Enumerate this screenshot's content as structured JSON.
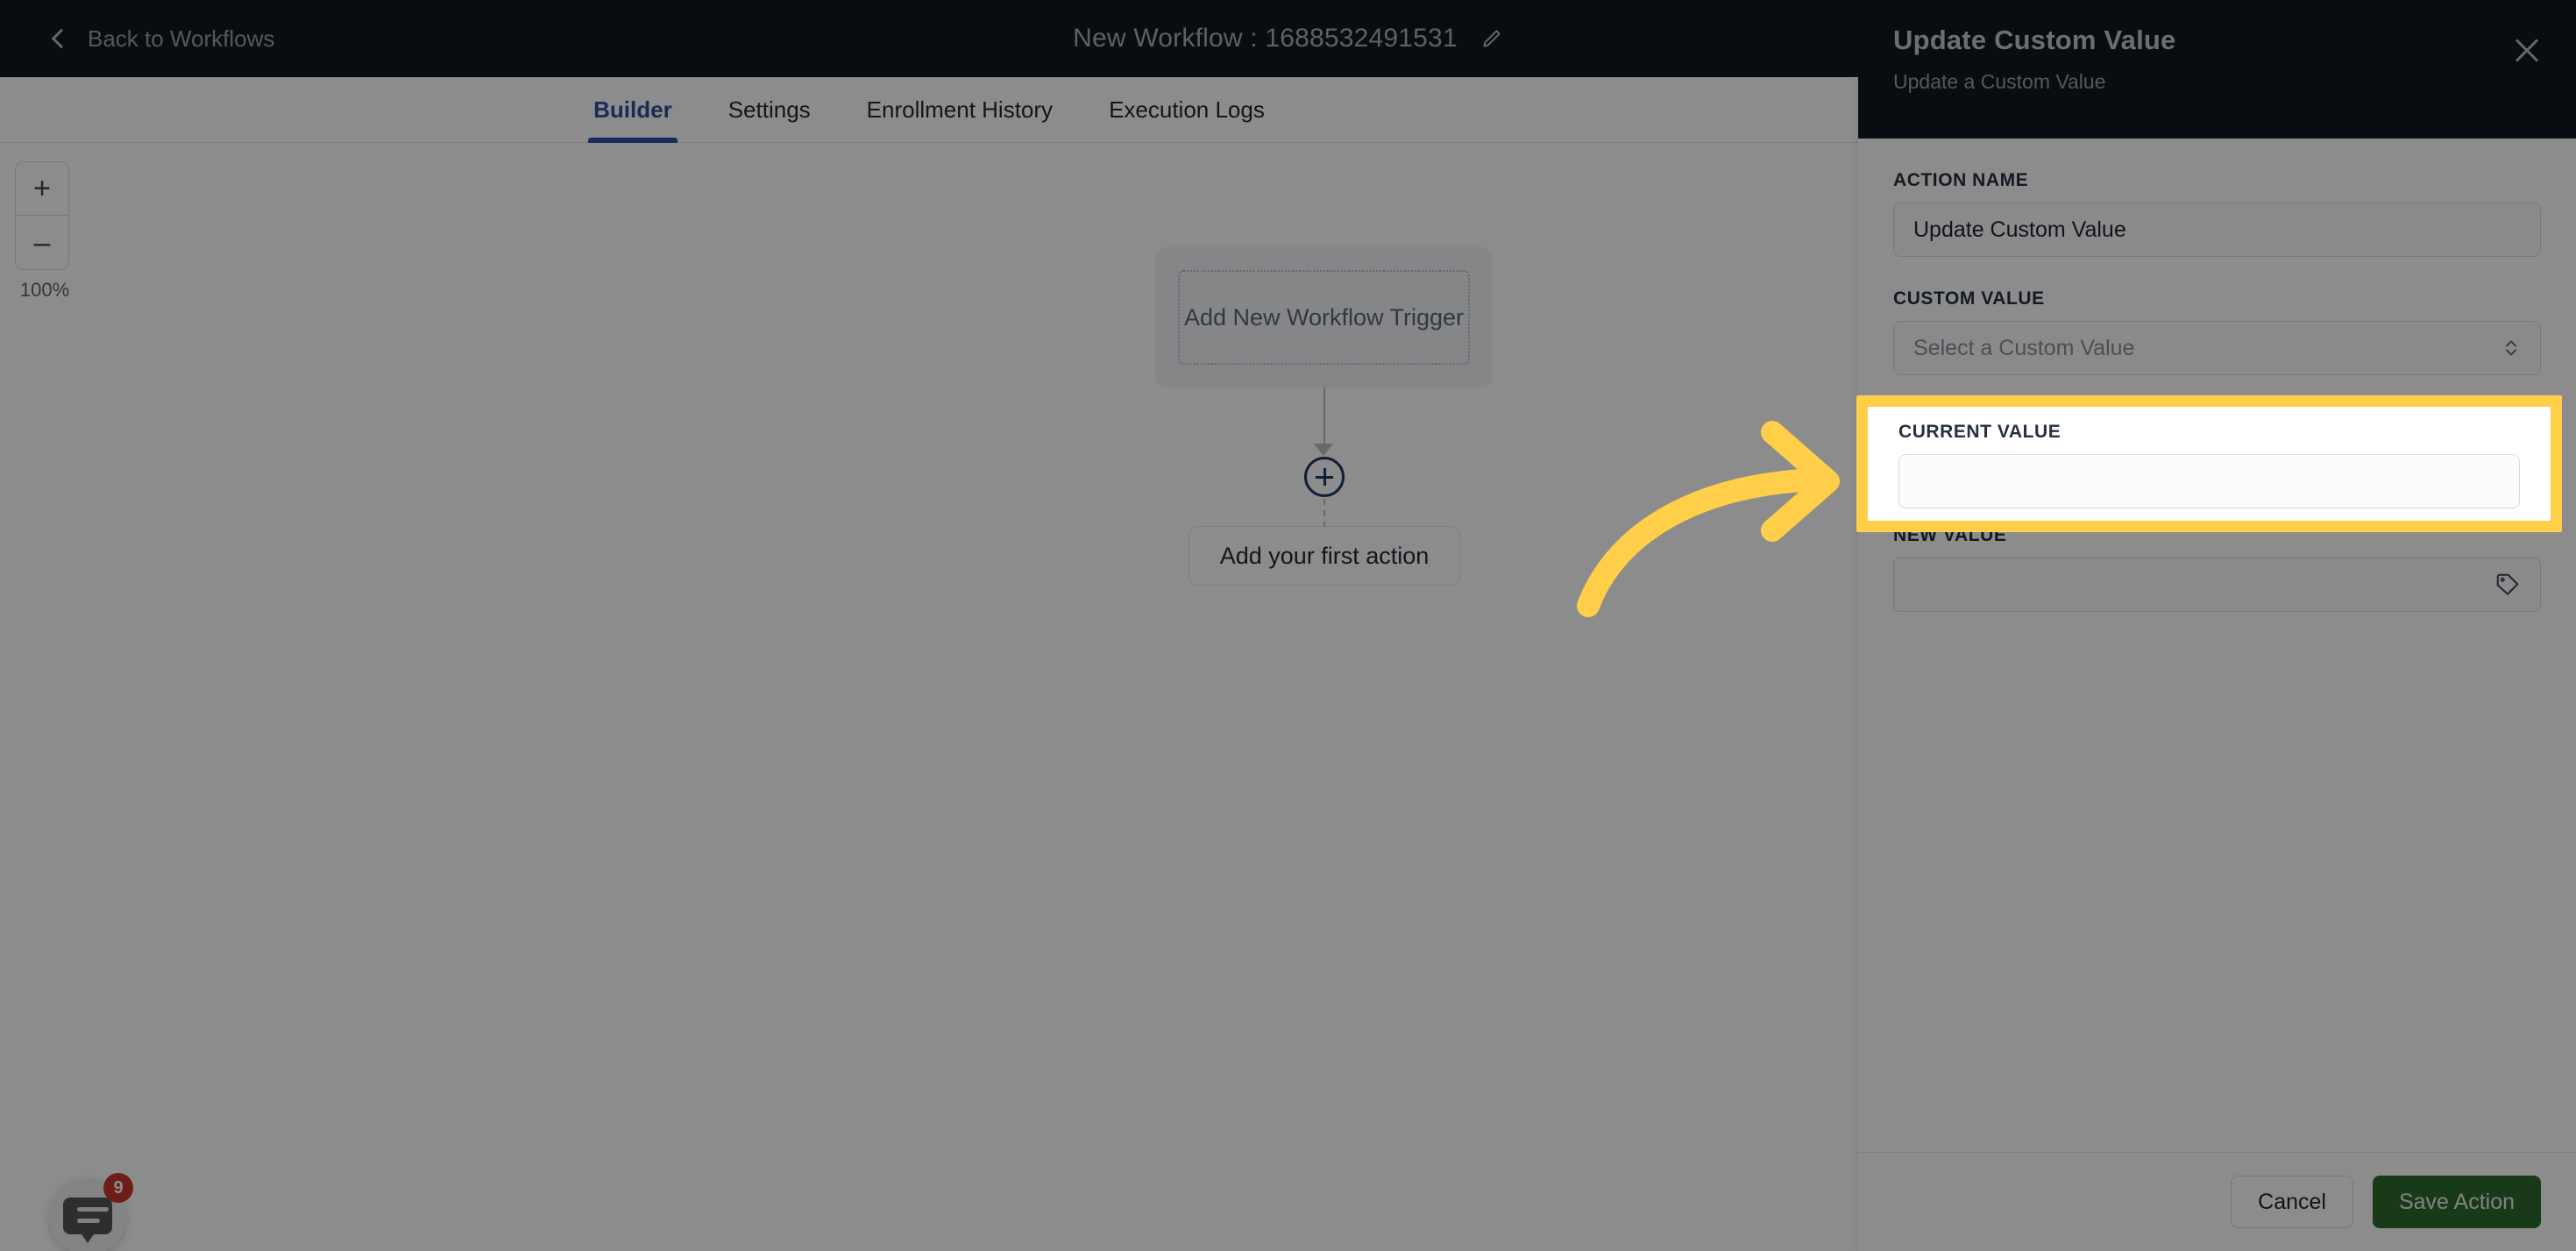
{
  "topbar": {
    "back_label": "Back to Workflows",
    "back_icon": "chevron-left-icon",
    "workflow_title": "New Workflow : 1688532491531",
    "edit_icon": "pencil-icon"
  },
  "tabs": [
    {
      "label": "Builder",
      "active": true
    },
    {
      "label": "Settings",
      "active": false
    },
    {
      "label": "Enrollment History",
      "active": false
    },
    {
      "label": "Execution Logs",
      "active": false
    }
  ],
  "canvas": {
    "zoom": {
      "plus_label": "+",
      "minus_label": "–",
      "level": "100%"
    },
    "trigger_label": "Add New Workflow Trigger",
    "add_node_icon": "plus-circle-icon",
    "first_action_label": "Add your first action",
    "chat": {
      "icon": "chat-bubble-icon",
      "badge": "9"
    }
  },
  "panel": {
    "title": "Update Custom Value",
    "subtitle": "Update a Custom Value",
    "close_icon": "close-icon",
    "fields": [
      {
        "label": "ACTION NAME",
        "value": "Update Custom Value",
        "placeholder": "",
        "icon": ""
      },
      {
        "label": "CUSTOM VALUE",
        "value": "",
        "placeholder": "Select a Custom Value",
        "icon": "chevron-up-down-icon"
      },
      {
        "label": "CURRENT VALUE",
        "value": "",
        "placeholder": "",
        "icon": ""
      },
      {
        "label": "NEW VALUE",
        "value": "",
        "placeholder": "",
        "icon": "tag-icon"
      }
    ],
    "footer": {
      "cancel_label": "Cancel",
      "save_label": "Save Action"
    }
  },
  "annotation": {
    "highlight_color": "#ffcf4a",
    "arrow_icon": "curved-arrow-right-icon",
    "target_field_label": "CURRENT VALUE"
  },
  "colors": {
    "dark_chrome": "#111821",
    "accent_blue": "#2f4f9e",
    "save_green": "#2e6b2c",
    "badge_red": "#c8372d",
    "highlight_yellow": "#ffcf4a"
  }
}
